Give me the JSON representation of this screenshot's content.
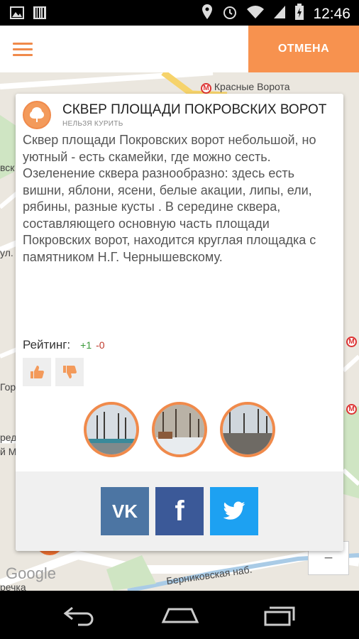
{
  "status_bar": {
    "time": "12:46",
    "icons": [
      "image-icon",
      "barcode-icon",
      "location-icon",
      "alarm-icon",
      "wifi-icon",
      "signal-icon",
      "battery-icon"
    ]
  },
  "app_bar": {
    "menu_icon": "menu-icon",
    "cancel_label": "ОТМЕНА",
    "accent_color": "#f7924f"
  },
  "map": {
    "labels": {
      "krasnye_vorota": "Красные Ворота",
      "berznikovskaya": "Берниковская наб.",
      "gor": "Гор",
      "vsk": "вск",
      "red": "ред",
      "yl": "ул.",
      "l_m": "й М",
      "ul_left": "ул.",
      "rechka": "речка"
    },
    "metro_symbol": "М",
    "google": "Google",
    "zoom_out": "−"
  },
  "place": {
    "icon": "tree-icon",
    "title": "СКВЕР ПЛОЩАДИ ПОКРОВСКИХ ВОРОТ",
    "subtitle": "НЕЛЬЗЯ КУРИТЬ",
    "description": "Сквер площади Покровских ворот небольшой, но уютный - есть скамейки, где можно сесть. Озеленение сквера разнообразно: здесь есть вишни, яблони, ясени, белые акации, липы, ели, рябины, разные кусты . В середине сквера, составляющего основную часть площади Покровских ворот, находится круглая площадка с памятником Н.Г. Чернышевскому.",
    "rating_label": "Рейтинг:",
    "rating_plus": "+1",
    "rating_minus": "-0"
  },
  "share": {
    "vk_label": "VK",
    "vk_color": "#4c75a3",
    "fb_label": "f",
    "fb_color": "#3b5998",
    "tw_color": "#1da1f2"
  }
}
